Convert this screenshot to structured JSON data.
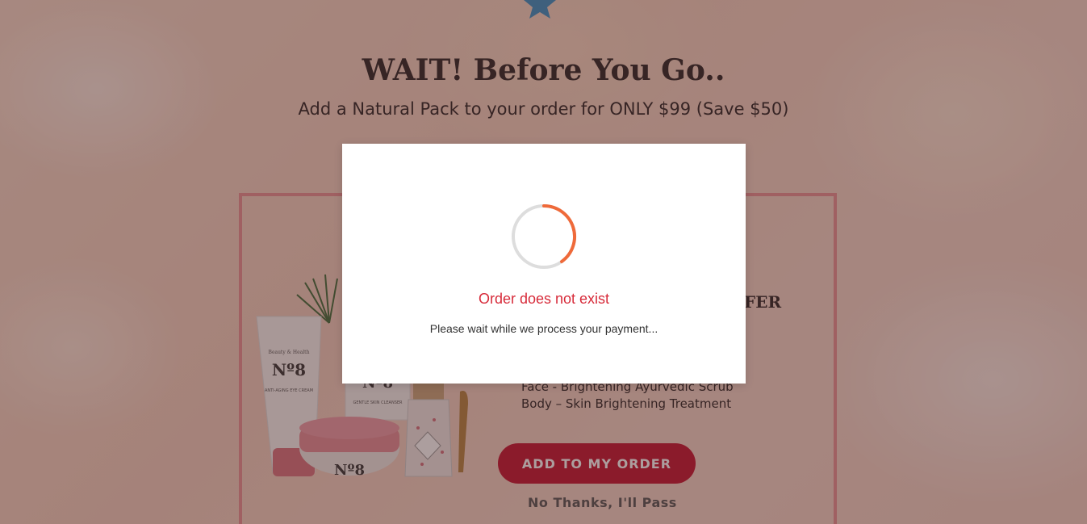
{
  "page": {
    "headline": "WAIT! Before You Go..",
    "subheadline": "Add a Natural Pack to your order for ONLY $99 (Save $50)"
  },
  "offer": {
    "title_partial": "FER",
    "features": [
      "Face - Brightening Ayurvedic Scrub",
      "Body – Skin Brightening Treatment"
    ],
    "add_button_label": "ADD TO MY ORDER",
    "decline_label": "No Thanks, I'll Pass",
    "product_labels": {
      "brand": "Beauty & Health",
      "number": "Nº8",
      "tube_text": "ANTI-AGING EYE CREAM",
      "cleanser_text": "GENTLE SKIN CLEANSER"
    }
  },
  "modal": {
    "error_text": "Order does not exist",
    "message": "Please wait while we process your payment..."
  },
  "colors": {
    "accent": "#c4122f",
    "error": "#d72b3a",
    "spinner": "#ef6a3a",
    "border": "#e98f93",
    "star": "#3a8fc4"
  },
  "icons": {
    "star": "star-icon",
    "spinner": "loading-spinner-icon"
  }
}
